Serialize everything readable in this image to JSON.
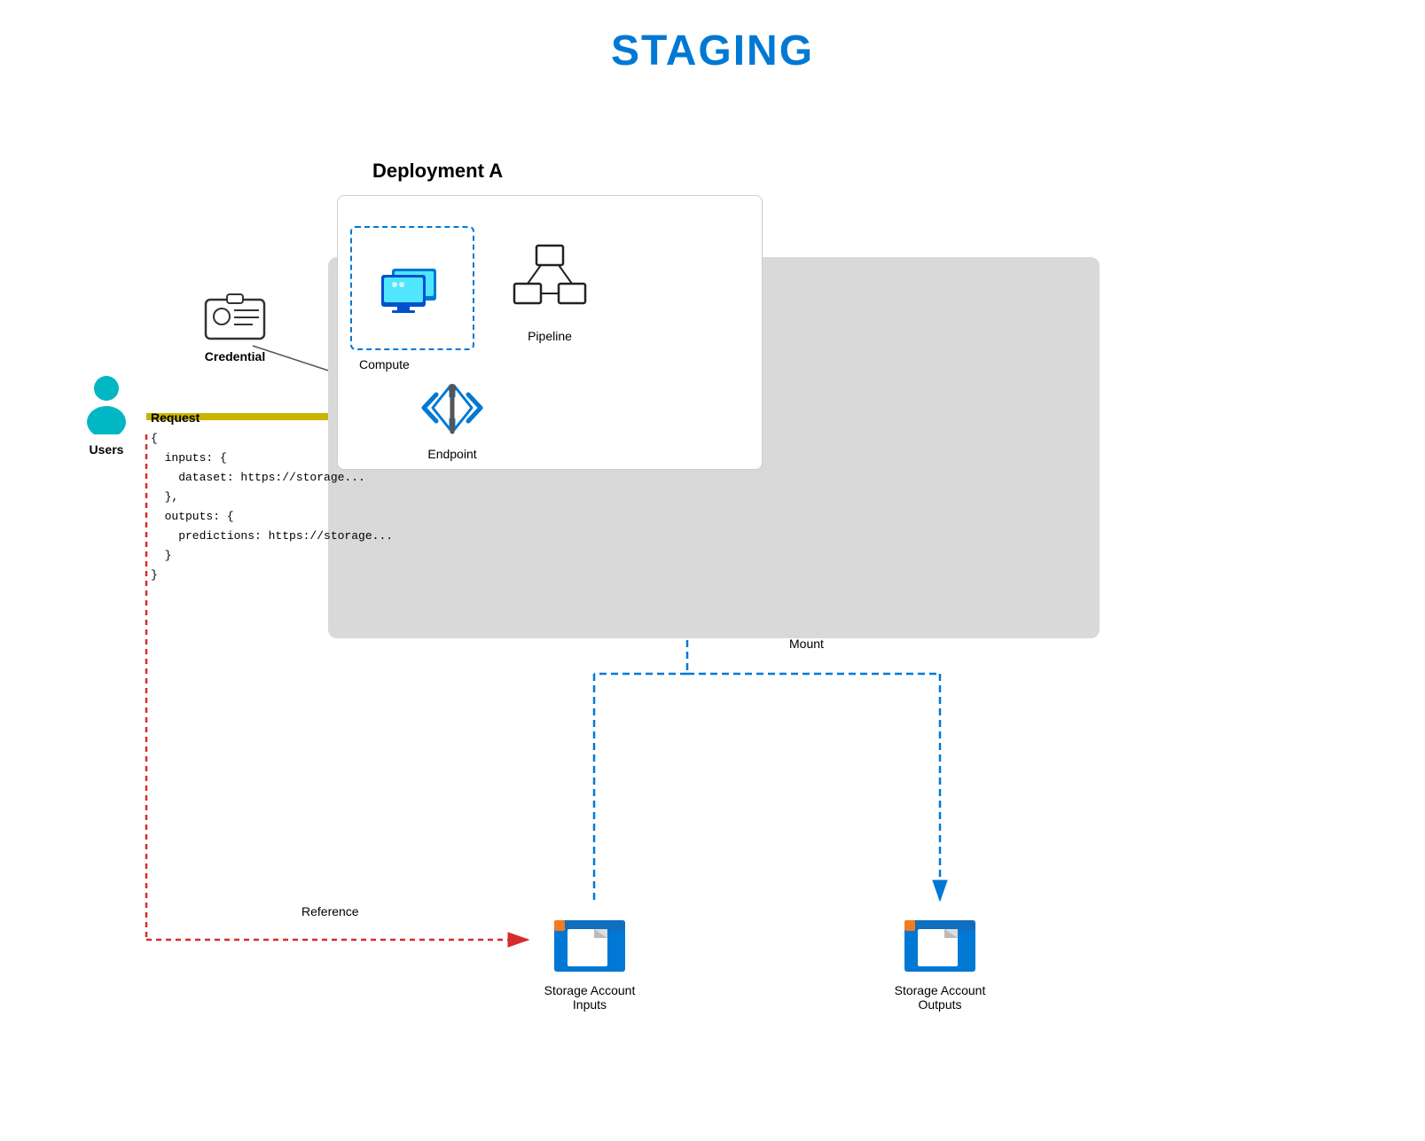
{
  "page": {
    "title": "STAGING",
    "title_color": "#0078d4"
  },
  "diagram": {
    "deployment_label": "Deployment A",
    "users_label": "Users",
    "credential_label": "Credential",
    "endpoint_label": "Endpoint",
    "compute_label": "Compute",
    "pipeline_label": "Pipeline",
    "storage_inputs_line1": "Storage Account",
    "storage_inputs_line2": "Inputs",
    "storage_outputs_line1": "Storage Account",
    "storage_outputs_line2": "Outputs",
    "mount_label": "Mount",
    "reference_label": "Reference",
    "request_label": "Request",
    "request_body": "{\n  inputs: {\n    dataset: https://storage...\n  },\n  outputs: {\n    predictions: https://storage...\n  }\n}"
  }
}
